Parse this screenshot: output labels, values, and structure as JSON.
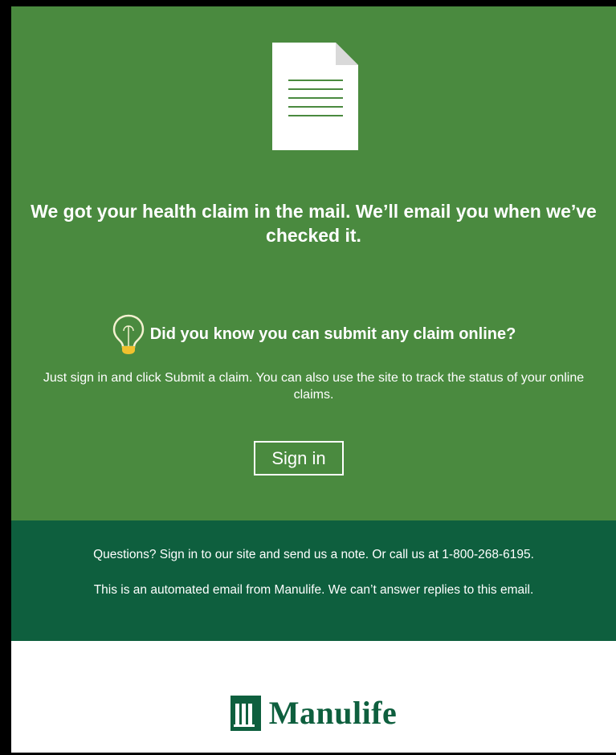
{
  "hero": {
    "headline": "We got your health claim in the mail. We’ll email you when we’ve checked it.",
    "promo_title": "Did you know you can submit any claim online?",
    "promo_text": "Just sign in and click Submit a claim. You can also use the site to track the status of your online claims.",
    "signin_label": "Sign in"
  },
  "footer": {
    "questions": "Questions? Sign in to our site and send us a note. Or call us at 1-800-268-6195.",
    "automated": "This is an automated email from Manulife. We can’t answer replies to this email."
  },
  "brand": {
    "logo_text": "Manulife"
  },
  "colors": {
    "hero_green": "#4a8a3f",
    "footer_green": "#0e5f3e",
    "brand_green": "#0e5f3e",
    "bulb_yellow": "#f2c12e"
  },
  "icons": {
    "document": "document-icon",
    "bulb": "lightbulb-icon",
    "logo_mark": "manulife-logo-mark"
  }
}
